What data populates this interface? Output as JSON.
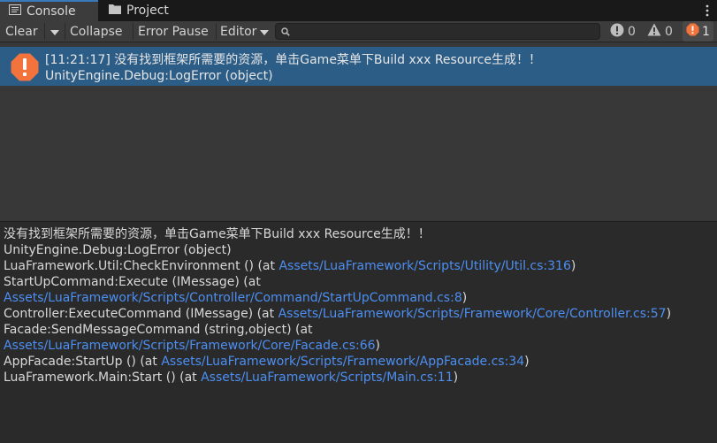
{
  "tabs": [
    {
      "label": "Console",
      "icon": "console-icon",
      "active": true
    },
    {
      "label": "Project",
      "icon": "folder-icon",
      "active": false
    }
  ],
  "toolbar": {
    "clear": "Clear",
    "collapse": "Collapse",
    "error_pause": "Error Pause",
    "editor": "Editor",
    "search_value": ""
  },
  "counts": {
    "logs": "0",
    "warnings": "0",
    "errors": "1"
  },
  "entry": {
    "line1": "[11:21:17] 没有找到框架所需要的资源，单击Game菜单下Build xxx Resource生成！！",
    "line2": "UnityEngine.Debug:LogError (object)"
  },
  "detail": {
    "l1": "没有找到框架所需要的资源，单击Game菜单下Build xxx Resource生成！！",
    "l2": "UnityEngine.Debug:LogError (object)",
    "l3_text": "LuaFramework.Util:CheckEnvironment () (at ",
    "l3_link": "Assets/LuaFramework/Scripts/Utility/Util.cs:316",
    "l4_text": "StartUpCommand:Execute (IMessage) (at",
    "l5_link": "Assets/LuaFramework/Scripts/Controller/Command/StartUpCommand.cs:8",
    "l6_text": "Controller:ExecuteCommand (IMessage) (at ",
    "l6_link": "Assets/LuaFramework/Scripts/Framework/Core/Controller.cs:57",
    "l7_text": "Facade:SendMessageCommand (string,object) (at",
    "l8_link": "Assets/LuaFramework/Scripts/Framework/Core/Facade.cs:66",
    "l9_text": "AppFacade:StartUp () (at ",
    "l9_link": "Assets/LuaFramework/Scripts/Framework/AppFacade.cs:34",
    "l10_text": "LuaFramework.Main:Start () (at ",
    "l10_link": "Assets/LuaFramework/Scripts/Main.cs:11",
    "close_paren": ")"
  },
  "colors": {
    "selection": "#2c5d87",
    "link": "#4c8ff2",
    "error": "#f2743c",
    "tab_accent": "#3a79bb"
  }
}
